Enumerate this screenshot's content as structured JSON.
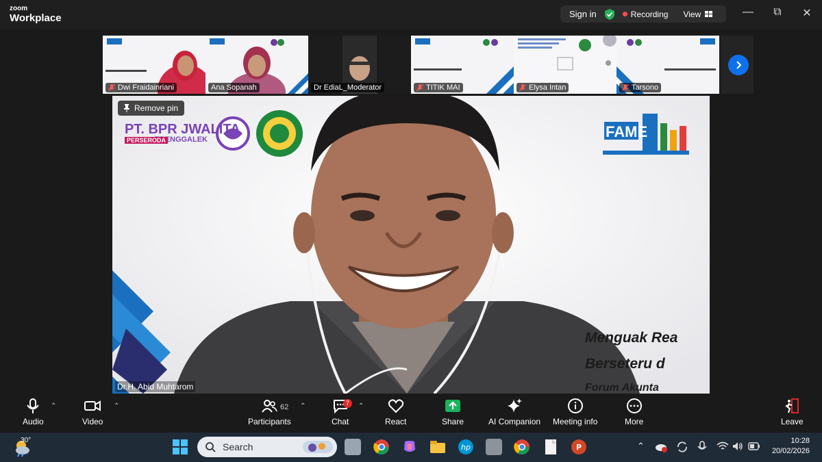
{
  "app": {
    "brand_small": "zoom",
    "brand_big": "Workplace"
  },
  "header": {
    "sign_in": "Sign in",
    "recording": "Recording",
    "view": "View"
  },
  "thumbnails": [
    {
      "name": "Dwi Fraidainriani",
      "muted": true
    },
    {
      "name": "Ana Sopanah",
      "muted": false
    },
    {
      "name": "Dr EdiaL_Moderator",
      "muted": false
    },
    {
      "name": "TITIK MAI",
      "muted": true
    },
    {
      "name": "Elysa Intan",
      "muted": true
    },
    {
      "name": "Tarsono",
      "muted": true
    }
  ],
  "main": {
    "remove_pin": "Remove pin",
    "speaker": "Dr.H. Abid Muhtarom",
    "bpr_line1": "PT. BPR JWALITA",
    "bpr_line2": "TRENGGALEK",
    "bpr_tag": "PERSERODA",
    "fame_logo": "FAME",
    "slide_line1": "Menguak Rea",
    "slide_line2": "Berseteru d",
    "slide_line3": "Forum Akunta"
  },
  "toolbar": {
    "audio": "Audio",
    "video": "Video",
    "participants": "Participants",
    "participants_count": "62",
    "chat": "Chat",
    "chat_badge": "7",
    "react": "React",
    "share": "Share",
    "ai_companion": "AI Companion",
    "meeting_info": "Meeting info",
    "more": "More",
    "leave": "Leave"
  },
  "taskbar": {
    "temperature": "30°",
    "search_placeholder": "Search",
    "time": "10:28",
    "date": "20/02/2026"
  },
  "colors": {
    "accent_blue": "#0e71eb",
    "recording_red": "#ff4d4f",
    "share_green": "#1bb25c",
    "leave_red": "#e02828"
  }
}
